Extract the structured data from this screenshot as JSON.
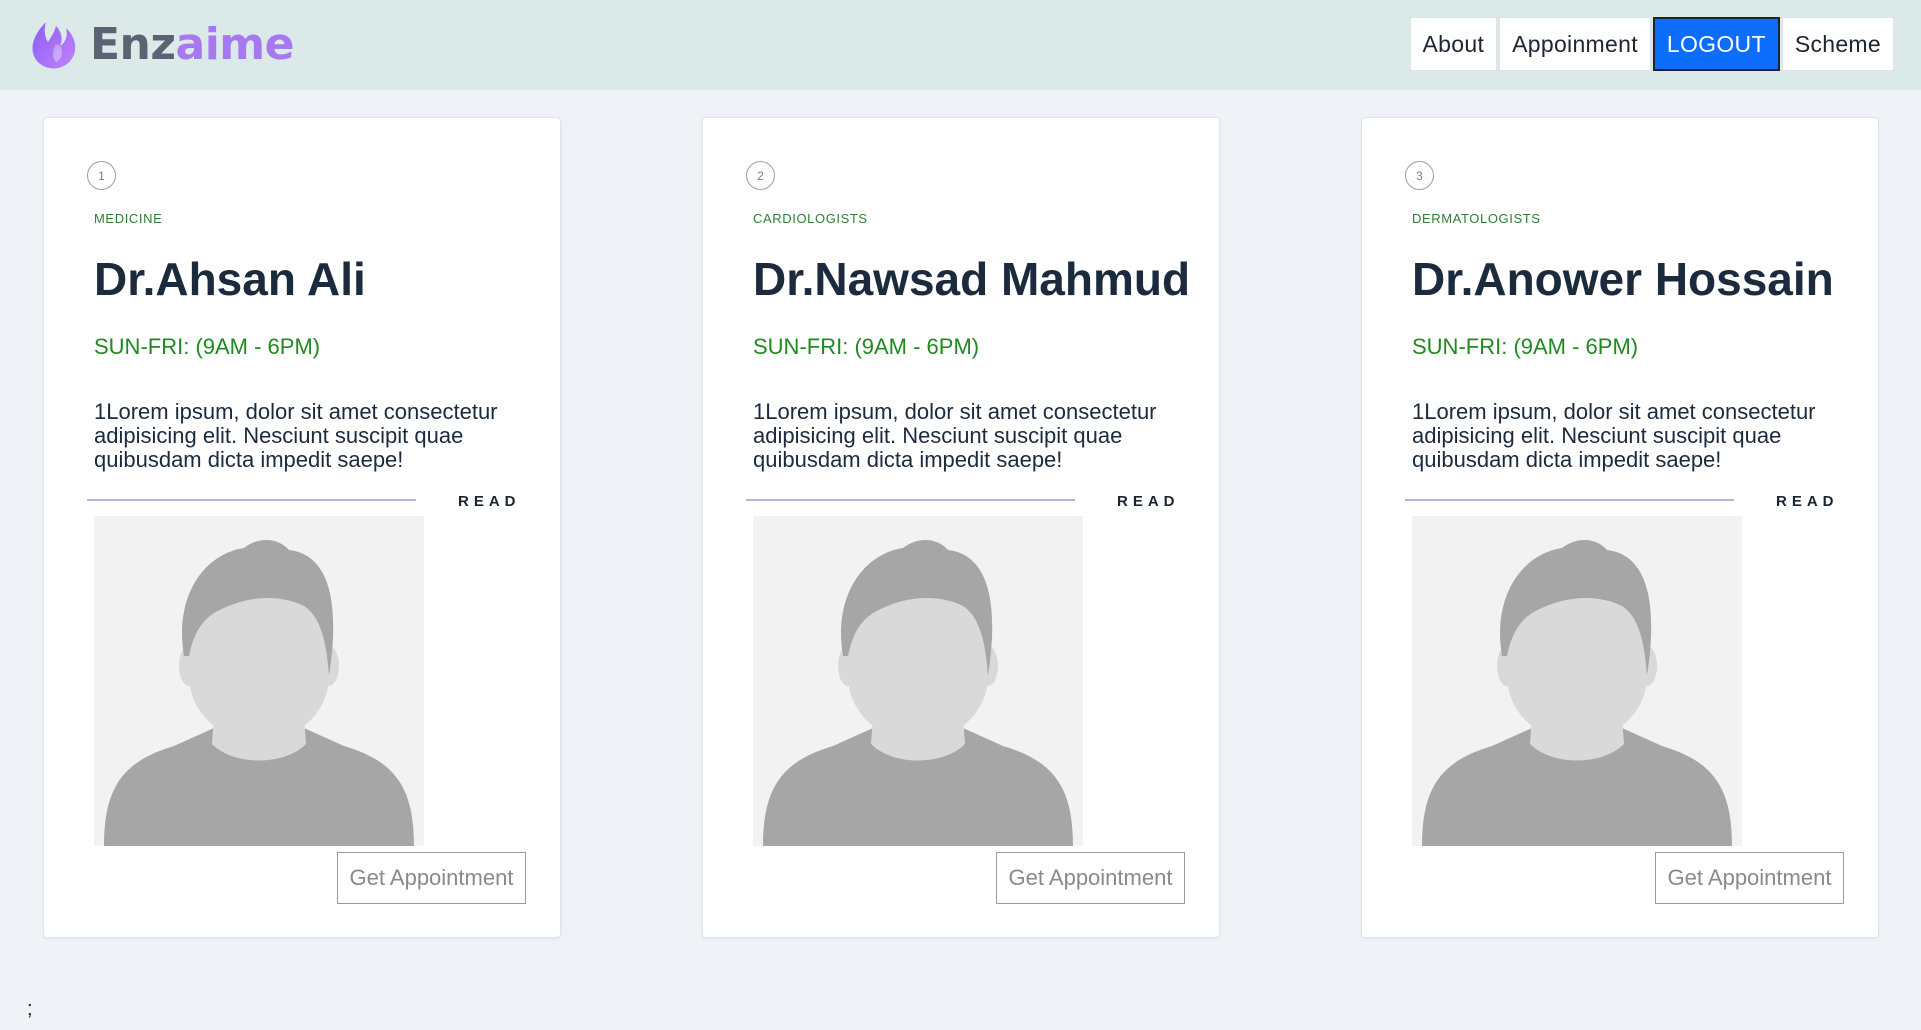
{
  "brand": {
    "name_part1": "Enz",
    "name_part2": "aime",
    "icon": "flame-logo-icon"
  },
  "nav": {
    "items": [
      {
        "label": "About"
      },
      {
        "label": "Appoinment"
      },
      {
        "label": "LOGOUT",
        "active": true
      },
      {
        "label": "Scheme"
      }
    ]
  },
  "cards": [
    {
      "number": "1",
      "category": "MEDICINE",
      "name": "Dr.Ahsan Ali",
      "hours": "SUN-FRI: (9AM - 6PM)",
      "description": "1Lorem ipsum, dolor sit amet consectetur adipisicing elit. Nesciunt suscipit quae quibusdam dicta impedit saepe!",
      "read_label": "READ",
      "button_label": "Get Appointment",
      "photo_icon": "avatar-placeholder-icon"
    },
    {
      "number": "2",
      "category": "CARDIOLOGISTS",
      "name": "Dr.Nawsad Mahmud",
      "hours": "SUN-FRI: (9AM - 6PM)",
      "description": "1Lorem ipsum, dolor sit amet consectetur adipisicing elit. Nesciunt suscipit quae quibusdam dicta impedit saepe!",
      "read_label": "READ",
      "button_label": "Get Appointment",
      "photo_icon": "avatar-placeholder-icon"
    },
    {
      "number": "3",
      "category": "DERMATOLOGISTS",
      "name": "Dr.Anower Hossain",
      "hours": "SUN-FRI: (9AM - 6PM)",
      "description": "1Lorem ipsum, dolor sit amet consectetur adipisicing elit. Nesciunt suscipit quae quibusdam dicta impedit saepe!",
      "read_label": "READ",
      "button_label": "Get Appointment",
      "photo_icon": "avatar-placeholder-icon"
    }
  ],
  "footer": {
    "text": ";"
  },
  "colors": {
    "page_bg": "#eff2f7",
    "navbar_bg": "#dce9e9",
    "logout_bg": "#0d6efd",
    "category": "#2f7d32",
    "hours": "#1f8a1f",
    "brand_accent": "#a779f0"
  }
}
